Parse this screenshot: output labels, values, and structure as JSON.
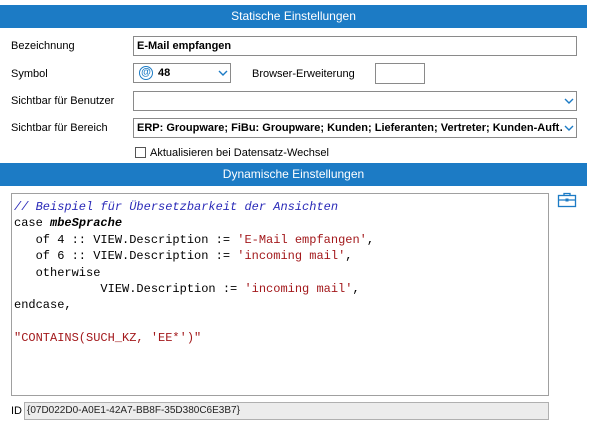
{
  "static_section": {
    "title": "Statische Einstellungen",
    "bezeichnung_label": "Bezeichnung",
    "bezeichnung_value": "E-Mail empfangen",
    "symbol_label": "Symbol",
    "symbol_value": "48",
    "symbol_icon": "at-sign-icon",
    "symbol_icon_glyph": "@",
    "browser_label": "Browser-Erweiterung",
    "browser_value": "",
    "sichtbar_benutzer_label": "Sichtbar für Benutzer",
    "sichtbar_benutzer_value": "",
    "sichtbar_bereich_label": "Sichtbar für Bereich",
    "sichtbar_bereich_value": "ERP: Groupware; FiBu: Groupware; Kunden; Lieferanten; Vertreter; Kunden-Auft…",
    "aktualisieren_label": "Aktualisieren bei Datensatz-Wechsel",
    "aktualisieren_checked": false
  },
  "dynamic_section": {
    "title": "Dynamische Einstellungen",
    "code": {
      "line1": "// Beispiel für Übersetzbarkeit der Ansichten",
      "line2_kw": "case ",
      "line2_var": "mbeSprache",
      "line3_pre": "   of 4 :: VIEW.Description := ",
      "line3_str": "'E-Mail empfangen'",
      "line3_post": ",",
      "line4_pre": "   of 6 :: VIEW.Description := ",
      "line4_str": "'incoming mail'",
      "line4_post": ",",
      "line5": "   otherwise",
      "line6_pre": "            VIEW.Description := ",
      "line6_str": "'incoming mail'",
      "line6_post": ",",
      "line7": "endcase,",
      "line8": "",
      "line9_str": "\"CONTAINS(SUCH_KZ, 'EE*')\""
    }
  },
  "id_label": "ID",
  "id_value": "{07D022D0-A0E1-42A7-BB8F-35D380C6E3B7}",
  "colors": {
    "header_bg": "#1c7bc5",
    "comment": "#2a2ab8",
    "string": "#a3191c"
  }
}
